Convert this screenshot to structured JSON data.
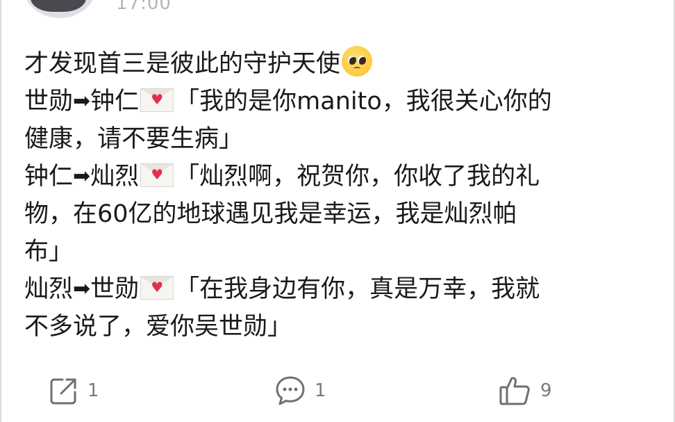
{
  "post": {
    "timestamp": "17:00",
    "lines": [
      {
        "text": "才发现首三是彼此的守护天使"
      },
      {
        "from": "世勋",
        "arrow": "➡",
        "to": "钟仁",
        "text": "「我的是你manito，我很关心你的"
      },
      {
        "text": "健康，请不要生病」"
      },
      {
        "from": "钟仁",
        "arrow": "➡",
        "to": "灿烈",
        "text": "「灿烈啊，祝贺你，你收了我的礼"
      },
      {
        "text": "物，在60亿的地球遇见我是幸运，我是灿烈帕"
      },
      {
        "text": "布」"
      },
      {
        "from": "灿烈",
        "arrow": "➡",
        "to": "世勋",
        "text": "「在我身边有你，真是万幸，我就"
      },
      {
        "text": "不多说了，爱你吴世勋」"
      }
    ],
    "emoji_pleading": "pleading-face-emoji",
    "envelope": "love-letter-emoji"
  },
  "actions": {
    "share": {
      "icon": "share-icon",
      "count": "1"
    },
    "comment": {
      "icon": "comment-icon",
      "count": "1"
    },
    "like": {
      "icon": "thumbs-up-icon",
      "count": "9"
    }
  },
  "colors": {
    "text": "#1a1a1a",
    "meta": "#b5b5b5",
    "action": "#7a7a7a",
    "heart": "#e0314b"
  }
}
